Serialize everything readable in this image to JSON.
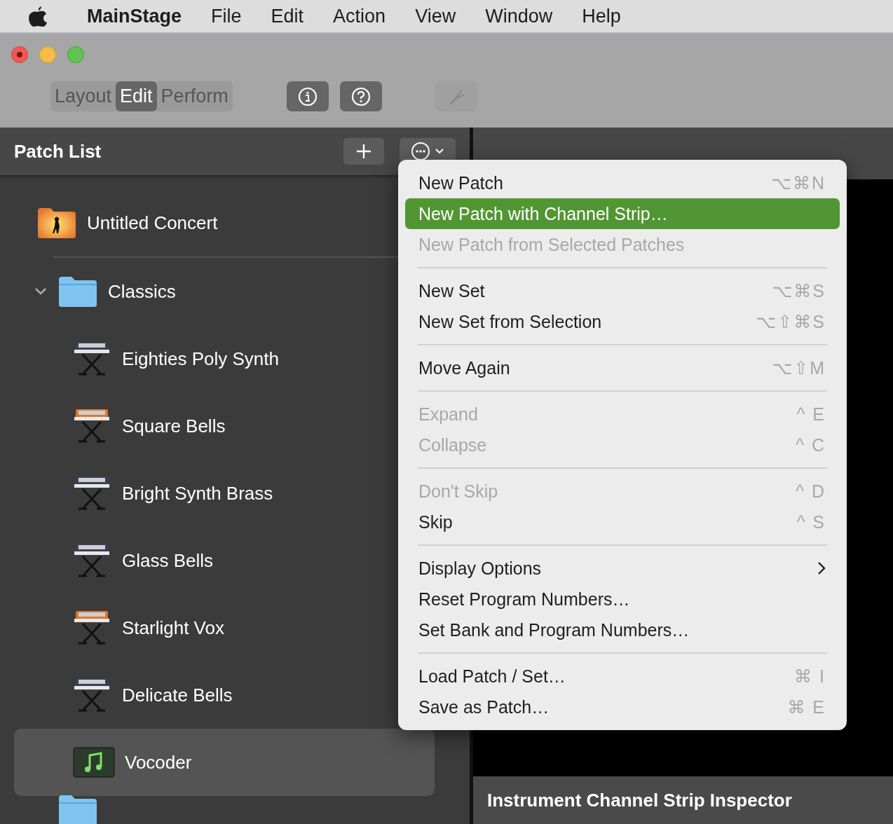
{
  "menu_bar": {
    "app": "MainStage",
    "items": [
      "File",
      "Edit",
      "Action",
      "View",
      "Window",
      "Help"
    ]
  },
  "toolbar": {
    "modes": [
      {
        "label": "Layout",
        "selected": false
      },
      {
        "label": "Edit",
        "selected": true
      },
      {
        "label": "Perform",
        "selected": false
      }
    ],
    "buttons": [
      {
        "kind": "info",
        "disabled": false
      },
      {
        "kind": "help",
        "disabled": false
      },
      {
        "kind": "tuner",
        "disabled": true
      }
    ]
  },
  "patch_list": {
    "title": "Patch List",
    "items": [
      {
        "kind": "concert",
        "label": "Untitled Concert",
        "selected": false
      },
      {
        "kind": "folder",
        "label": "Classics",
        "expanded": true,
        "selected": false,
        "children": [
          {
            "kind": "synth-dark",
            "label": "Eighties Poly Synth",
            "selected": false
          },
          {
            "kind": "synth-orange",
            "label": "Square Bells",
            "selected": false
          },
          {
            "kind": "synth-dark",
            "label": "Bright Synth Brass",
            "selected": false
          },
          {
            "kind": "synth-dark",
            "label": "Glass Bells",
            "selected": false
          },
          {
            "kind": "synth-orange",
            "label": "Starlight Vox",
            "selected": false
          },
          {
            "kind": "synth-dark",
            "label": "Delicate Bells",
            "selected": false
          },
          {
            "kind": "music",
            "label": "Vocoder",
            "selected": true
          }
        ]
      },
      {
        "kind": "folder",
        "selected": false
      }
    ]
  },
  "context_menu": [
    {
      "kind": "item",
      "label": "New Patch",
      "shortcut": "⌥⌘N",
      "disabled": false,
      "selected": false
    },
    {
      "kind": "item",
      "label": "New Patch with Channel Strip…",
      "selected": true,
      "disabled": false
    },
    {
      "kind": "item",
      "label": "New Patch from Selected Patches",
      "disabled": true,
      "selected": false
    },
    {
      "kind": "separator"
    },
    {
      "kind": "item",
      "label": "New Set",
      "shortcut": "⌥⌘S",
      "disabled": false,
      "selected": false
    },
    {
      "kind": "item",
      "label": "New Set from Selection",
      "shortcut": "⌥⇧⌘S",
      "disabled": false,
      "selected": false
    },
    {
      "kind": "separator"
    },
    {
      "kind": "item",
      "label": "Move Again",
      "shortcut": "⌥⇧M",
      "disabled": false,
      "selected": false
    },
    {
      "kind": "separator"
    },
    {
      "kind": "item",
      "label": "Expand",
      "shortcut": "^ E",
      "disabled": true,
      "selected": false
    },
    {
      "kind": "item",
      "label": "Collapse",
      "shortcut": "^ C",
      "disabled": true,
      "selected": false
    },
    {
      "kind": "separator"
    },
    {
      "kind": "item",
      "label": "Don't Skip",
      "shortcut": "^ D",
      "disabled": true,
      "selected": false
    },
    {
      "kind": "item",
      "label": "Skip",
      "shortcut": "^ S",
      "disabled": false,
      "selected": false
    },
    {
      "kind": "separator"
    },
    {
      "kind": "item",
      "label": "Display Options",
      "submenu": true,
      "disabled": false,
      "selected": false
    },
    {
      "kind": "item",
      "label": "Reset Program Numbers…",
      "disabled": false,
      "selected": false
    },
    {
      "kind": "item",
      "label": "Set Bank and Program Numbers…",
      "disabled": false,
      "selected": false
    },
    {
      "kind": "separator"
    },
    {
      "kind": "item",
      "label": "Load Patch / Set…",
      "shortcut": "⌘ I",
      "disabled": false,
      "selected": false
    },
    {
      "kind": "item",
      "label": "Save as Patch…",
      "shortcut": "⌘ E",
      "disabled": false,
      "selected": false
    }
  ],
  "inspector": {
    "title": "Instrument Channel Strip Inspector"
  }
}
